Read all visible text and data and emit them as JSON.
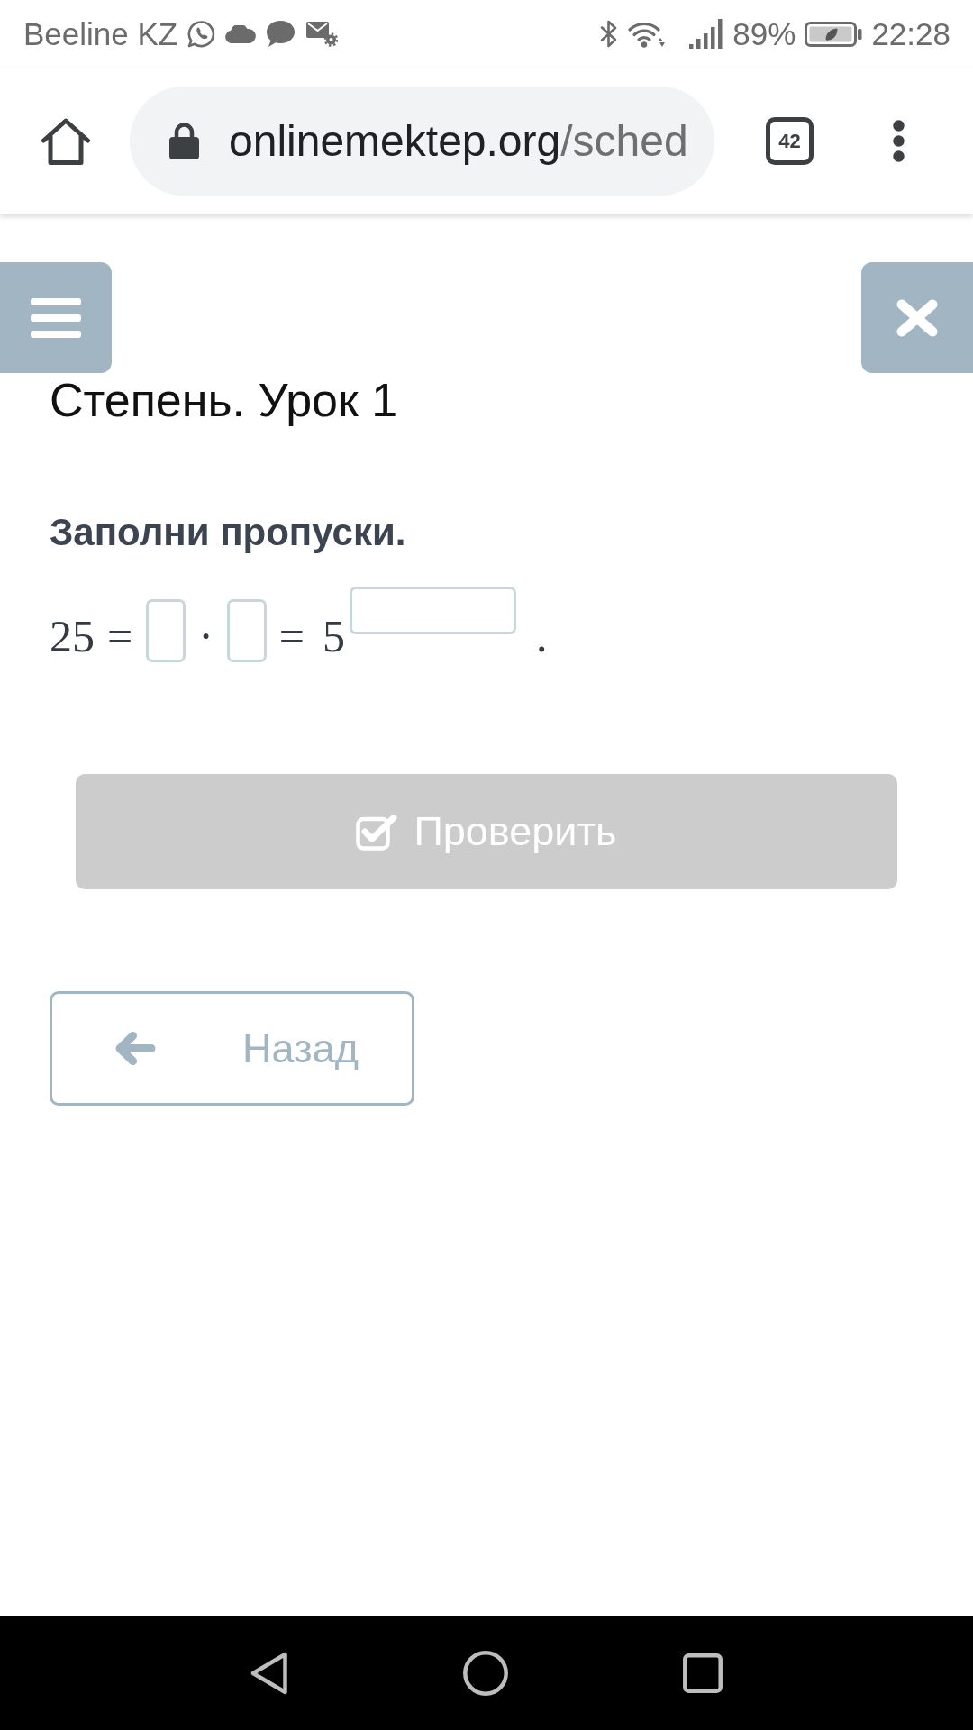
{
  "status_bar": {
    "carrier": "Beeline KZ",
    "battery": "89%",
    "time": "22:28"
  },
  "browser": {
    "url_host": "onlinemektep.org",
    "url_path": "/sched",
    "tab_count": "42"
  },
  "lesson": {
    "title": "Степень. Урок 1",
    "instruction": "Заполни пропуски."
  },
  "equation": [
    {
      "kind": "number",
      "text": "25"
    },
    {
      "kind": "operator",
      "text": "="
    },
    {
      "kind": "blank"
    },
    {
      "kind": "operator",
      "text": "·"
    },
    {
      "kind": "blank"
    },
    {
      "kind": "operator",
      "text": "="
    },
    {
      "kind": "number",
      "text": "5"
    },
    {
      "kind": "exponent_blank"
    },
    {
      "kind": "punctuation",
      "text": "."
    }
  ],
  "check_button": {
    "label": "Проверить",
    "disabled": true
  },
  "back_button": {
    "label": "Назад"
  }
}
